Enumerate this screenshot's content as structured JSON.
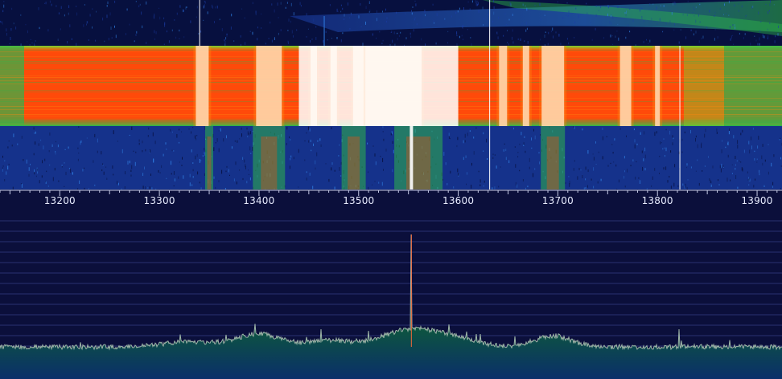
{
  "frequency_axis": {
    "unit": "",
    "min": 13140,
    "max": 13925,
    "labels": [
      "13200",
      "13300",
      "13400",
      "13500",
      "13600",
      "13700",
      "13800",
      "13900"
    ],
    "values": [
      13200,
      13300,
      13400,
      13500,
      13600,
      13700,
      13800,
      13900
    ]
  },
  "waterfall": {
    "palette": [
      "#07103f",
      "#1b3da5",
      "#2f7de0",
      "#2fb54a",
      "#7ad32c",
      "#ff4a0a",
      "#ff8a10",
      "#ffffff"
    ]
  },
  "spectrum": {
    "grid_lines": 13,
    "background": "#0b0f3b",
    "trace_color": "#9fb6a8",
    "fill_color": "#0e5a3a",
    "peak_frequency": 13553
  }
}
